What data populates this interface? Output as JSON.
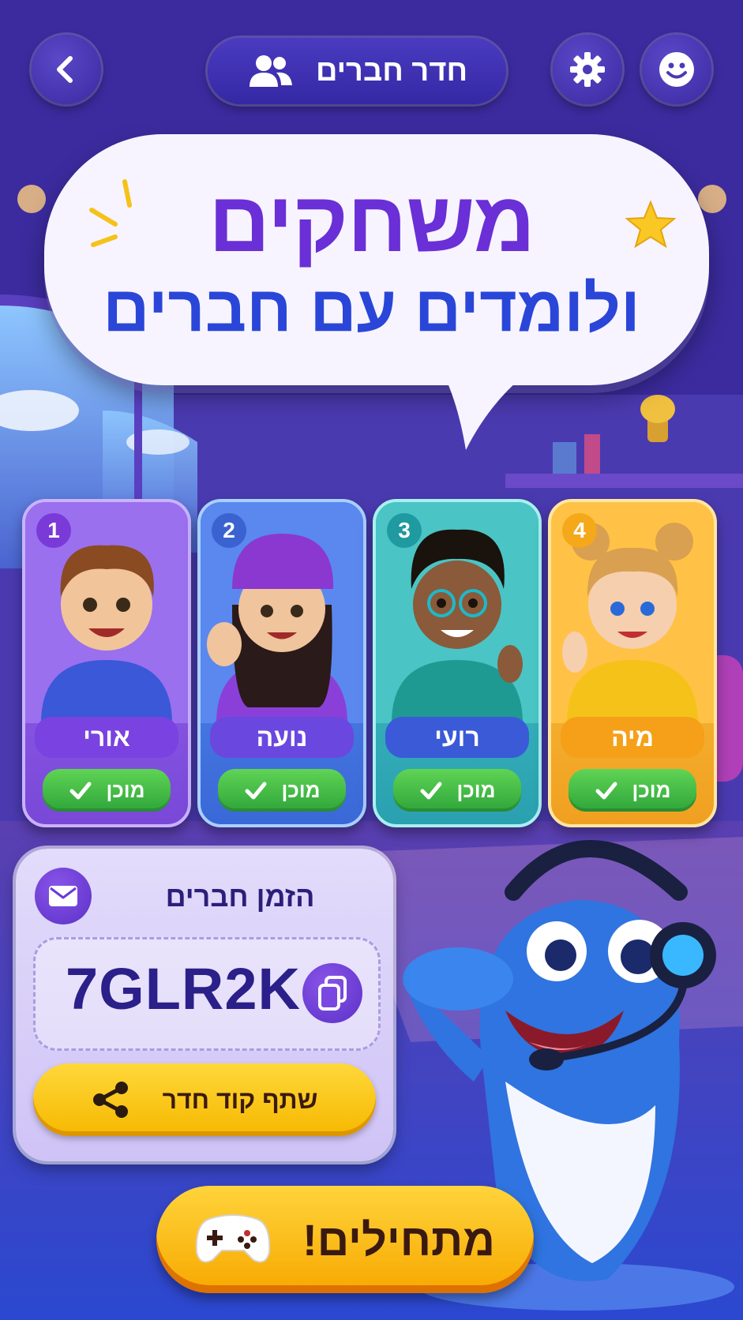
{
  "header": {
    "title": "חדר חברים",
    "back_icon": "chevron-left-icon",
    "settings_icon": "gear-icon",
    "emoji_icon": "smiley-icon",
    "title_icon": "users-icon"
  },
  "headline": {
    "line1": "משחקים",
    "line2": "ולומדים עם חברים"
  },
  "players": [
    {
      "number": "1",
      "name": "אורי",
      "status": "מוכן",
      "color": "#8a5ae8"
    },
    {
      "number": "2",
      "name": "נועה",
      "status": "מוכן",
      "color": "#4a78e8"
    },
    {
      "number": "3",
      "name": "רועי",
      "status": "מוכן",
      "color": "#2fb8c0"
    },
    {
      "number": "4",
      "name": "מיה",
      "status": "מוכן",
      "color": "#f6b21e"
    }
  ],
  "invite": {
    "title": "הזמן חברים",
    "code": "7GLR2K",
    "share_label": "שתף קוד חדר",
    "mail_icon": "envelope-icon",
    "copy_icon": "copy-icon",
    "share_icon": "share-icon"
  },
  "start_button": {
    "label": "מתחילים!",
    "icon": "gamepad-icon"
  },
  "colors": {
    "accent_purple": "#6a2fd6",
    "accent_blue": "#2a46d8",
    "ready_green": "#2fa53a",
    "button_yellow": "#f6b800"
  }
}
